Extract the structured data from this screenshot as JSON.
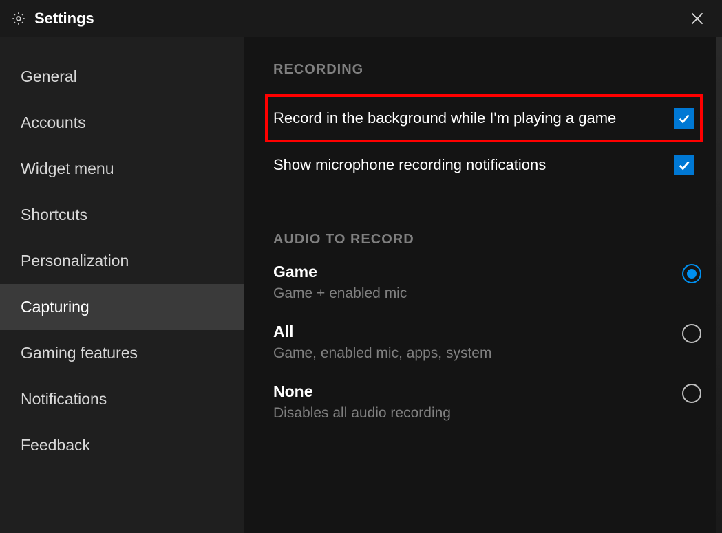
{
  "titlebar": {
    "title": "Settings"
  },
  "sidebar": {
    "items": [
      {
        "label": "General",
        "active": false
      },
      {
        "label": "Accounts",
        "active": false
      },
      {
        "label": "Widget menu",
        "active": false
      },
      {
        "label": "Shortcuts",
        "active": false
      },
      {
        "label": "Personalization",
        "active": false
      },
      {
        "label": "Capturing",
        "active": true
      },
      {
        "label": "Gaming features",
        "active": false
      },
      {
        "label": "Notifications",
        "active": false
      },
      {
        "label": "Feedback",
        "active": false
      }
    ]
  },
  "content": {
    "recording": {
      "header": "RECORDING",
      "options": [
        {
          "label": "Record in the background while I'm playing a game",
          "checked": true,
          "highlighted": true
        },
        {
          "label": "Show microphone recording notifications",
          "checked": true,
          "highlighted": false
        }
      ]
    },
    "audio": {
      "header": "AUDIO TO RECORD",
      "options": [
        {
          "title": "Game",
          "desc": "Game + enabled mic",
          "selected": true
        },
        {
          "title": "All",
          "desc": "Game, enabled mic, apps, system",
          "selected": false
        },
        {
          "title": "None",
          "desc": "Disables all audio recording",
          "selected": false
        }
      ]
    }
  },
  "colors": {
    "accent": "#0078d4",
    "highlight": "#ff0000"
  }
}
